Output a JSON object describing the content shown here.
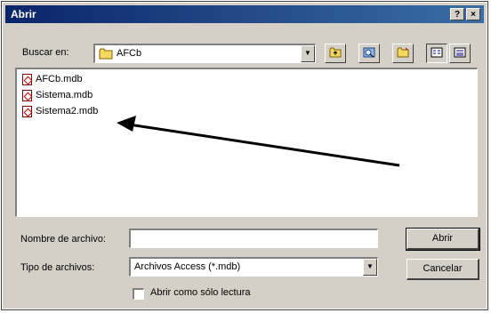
{
  "window": {
    "title": "Abrir",
    "help_btn": "?",
    "close_btn": "×"
  },
  "lookin": {
    "label": "Buscar en:",
    "value": "AFCb"
  },
  "files": [
    {
      "name": "AFCb.mdb"
    },
    {
      "name": "Sistema.mdb"
    },
    {
      "name": "Sistema2.mdb"
    }
  ],
  "filename": {
    "label": "Nombre de archivo:",
    "value": ""
  },
  "filetype": {
    "label": "Tipo de archivos:",
    "value": "Archivos Access (*.mdb)"
  },
  "readonly": {
    "label": "Abrir como sólo lectura",
    "checked": false
  },
  "buttons": {
    "open": "Abrir",
    "cancel": "Cancelar"
  },
  "colors": {
    "title_start": "#0a246a",
    "title_end": "#3a6ea5",
    "dialog_bg": "#d4d0c8",
    "folder": "#f6d860"
  }
}
